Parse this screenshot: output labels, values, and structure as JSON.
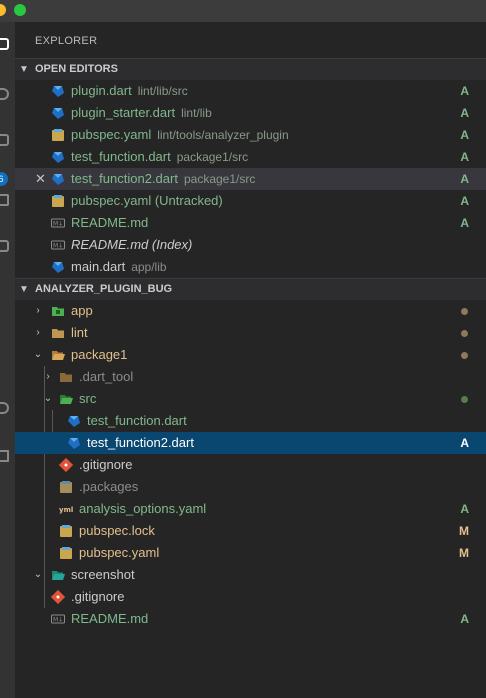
{
  "explorer_title": "EXPLORER",
  "open_editors": {
    "label": "OPEN EDITORS",
    "items": [
      {
        "name": "plugin.dart",
        "desc": "lint/lib/src",
        "badge": "A",
        "icon": "dart-icon"
      },
      {
        "name": "plugin_starter.dart",
        "desc": "lint/lib",
        "badge": "A",
        "icon": "dart-icon"
      },
      {
        "name": "pubspec.yaml",
        "desc": "lint/tools/analyzer_plugin",
        "badge": "A",
        "icon": "yaml-icon"
      },
      {
        "name": "test_function.dart",
        "desc": "package1/src",
        "badge": "A",
        "icon": "dart-icon"
      },
      {
        "name": "test_function2.dart",
        "desc": "package1/src",
        "badge": "A",
        "icon": "dart-icon"
      },
      {
        "name": "pubspec.yaml (Untracked)",
        "desc": "",
        "badge": "A",
        "icon": "yaml-icon"
      },
      {
        "name": "README.md",
        "desc": "",
        "badge": "A",
        "icon": "markdown-icon"
      },
      {
        "name": "README.md (Index)",
        "desc": "",
        "badge": "",
        "icon": "markdown-icon"
      },
      {
        "name": "main.dart",
        "desc": "app/lib",
        "badge": "",
        "icon": "dart-icon"
      }
    ]
  },
  "workspace": {
    "label": "ANALYZER_PLUGIN_BUG",
    "items": [
      {
        "name": "app",
        "badge": ""
      },
      {
        "name": "lint",
        "badge": ""
      },
      {
        "name": "package1",
        "badge": ""
      },
      {
        "name": ".dart_tool",
        "badge": ""
      },
      {
        "name": "src",
        "badge": ""
      },
      {
        "name": "test_function.dart",
        "badge": ""
      },
      {
        "name": "test_function2.dart",
        "badge": "A"
      },
      {
        "name": ".gitignore",
        "badge": ""
      },
      {
        "name": ".packages",
        "badge": ""
      },
      {
        "name": "analysis_options.yaml",
        "badge": "A"
      },
      {
        "name": "pubspec.lock",
        "badge": "M"
      },
      {
        "name": "pubspec.yaml",
        "badge": "M"
      },
      {
        "name": "screenshot",
        "badge": ""
      },
      {
        "name": ".gitignore",
        "badge": ""
      },
      {
        "name": "README.md",
        "badge": "A"
      }
    ]
  },
  "activity_badge": "6",
  "colors": {
    "added": "#81b88b",
    "modified": "#e2c08d",
    "selection": "#094771",
    "dart_blue": "#1f6fc4",
    "folder": "#c09553"
  }
}
